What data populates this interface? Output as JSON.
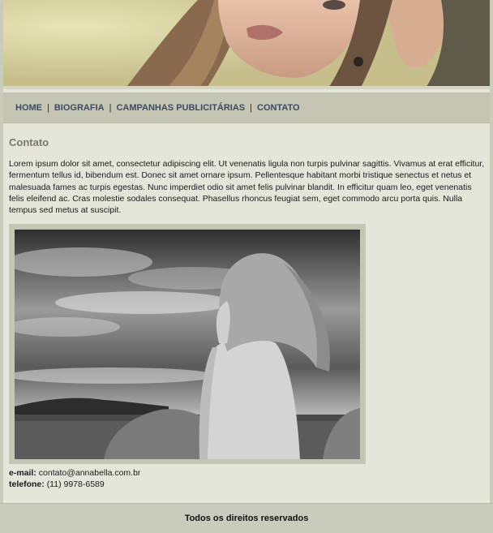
{
  "header": {
    "banner_image": "woman-portrait-banner"
  },
  "nav": {
    "items": [
      {
        "label": "HOME"
      },
      {
        "label": "BIOGRAFIA"
      },
      {
        "label": "CAMPANHAS PUBLICITÁRIAS"
      },
      {
        "label": "CONTATO"
      }
    ],
    "separator": "|"
  },
  "main": {
    "title": "Contato",
    "paragraph": "Lorem ipsum dolor sit amet, consectetur adipiscing elit. Ut venenatis ligula non turpis pulvinar sagittis. Vivamus at erat efficitur, fermentum tellus id, bibendum est. Donec sit amet ornare ipsum. Pellentesque habitant morbi tristique senectus et netus et malesuada fames ac turpis egestas. Nunc imperdiet odio sit amet felis pulvinar blandit. In efficitur quam leo, eget venenatis felis eleifend ac. Cras molestie sodales consequat. Phasellus rhoncus feugiat sem, eget commodo arcu porta quis. Nulla tempus sed metus at suscipit.",
    "photo": "woman-by-sea-photo",
    "contact": {
      "email_label": "e-mail:",
      "email_value": "contato@annabella.com.br",
      "phone_label": "telefone:",
      "phone_value": "(11) 9978-6589"
    }
  },
  "footer": {
    "text": "Todos os direitos reservados"
  },
  "colors": {
    "page_bg": "#e5e6da",
    "nav_bg": "#c4c6b3",
    "nav_text": "#3d4a63",
    "title_text": "#7a7869",
    "outer_bg": "#c9cbbd"
  }
}
